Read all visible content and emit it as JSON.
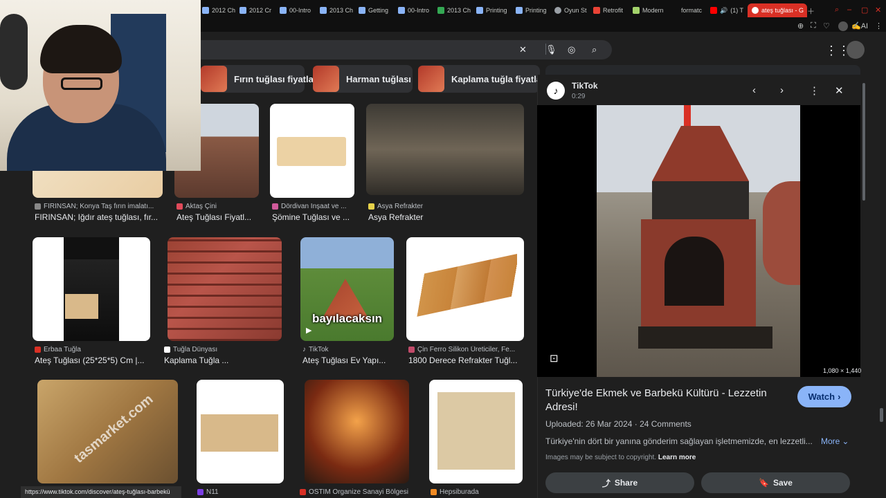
{
  "tabs": [
    {
      "label": "2012 Ch"
    },
    {
      "label": "2012 Cr"
    },
    {
      "label": "00-Intro"
    },
    {
      "label": "2013 Ch"
    },
    {
      "label": "Getting"
    },
    {
      "label": "00-Intro"
    },
    {
      "label": "2013 Ch"
    },
    {
      "label": "Printing"
    },
    {
      "label": "Printing"
    },
    {
      "label": "Oyun St"
    },
    {
      "label": "Retrofit"
    },
    {
      "label": "Modern"
    },
    {
      "label": "formatc"
    },
    {
      "label": "(1) T"
    },
    {
      "label": "ateş tuğlası - G"
    }
  ],
  "toolbar": {
    "ai_label": "AI"
  },
  "chips": [
    {
      "label": "Fırın tuğlası fiyatları"
    },
    {
      "label": "Harman tuğlası"
    },
    {
      "label": "Kaplama tuğla fiyatları"
    }
  ],
  "results": [
    {
      "source": "FIRINSAN; Konya Taş fırın imalatı...",
      "title": "FIRINSAN; Iğdır ateş tuğlası, fır..."
    },
    {
      "source": "Aktaş Çini",
      "title": "Ateş Tuğlası Fiyatl..."
    },
    {
      "source": "Dördivan İnşaat ve ...",
      "title": "Şömine Tuğlası ve ..."
    },
    {
      "source": "Asya Refrakter",
      "title": "Asya Refrakter"
    },
    {
      "source": "Erbaa Tuğla",
      "title": "Ateş Tuğlası (25*25*5) Cm |..."
    },
    {
      "source": "Tuğla Dünyası",
      "title": "Kaplama Tuğla ..."
    },
    {
      "source": "TikTok",
      "title": "Ateş Tuğlası Ev Yapı..."
    },
    {
      "source": "Çin Ferro Silikon Üreticiler, Fe...",
      "title": "1800 Derece Refrakter Tuğl..."
    },
    {
      "source": "N11"
    },
    {
      "source": "OSTİM Organize Sanayi Bölgesi"
    },
    {
      "source": "Hepsiburada"
    }
  ],
  "tiktok_overlay": "bayılacaksın",
  "watermark": "tasmarket.com",
  "panel": {
    "source_name": "TikTok",
    "duration": "0:29",
    "dimensions": "1,080 × 1,440",
    "title": "Türkiye'de Ekmek ve Barbekü Kültürü - Lezzetin Adresi!",
    "watch_label": "Watch",
    "meta": "Uploaded: 26 Mar 2024 · 24 Comments",
    "description": "Türkiye'nin dört bir yanına gönderim sağlayan işletmemizde, en lezzetli...",
    "more_label": "More",
    "copyright": "Images may be subject to copyright.",
    "learn_more": "Learn more",
    "share_label": "Share",
    "save_label": "Save"
  },
  "status_url": "https://www.tiktok.com/discover/ateş-tuğlası-barbekü",
  "colors": {
    "accent": "#8ab4f8",
    "bg": "#1f1f1f",
    "active_tab": "#d93025"
  }
}
